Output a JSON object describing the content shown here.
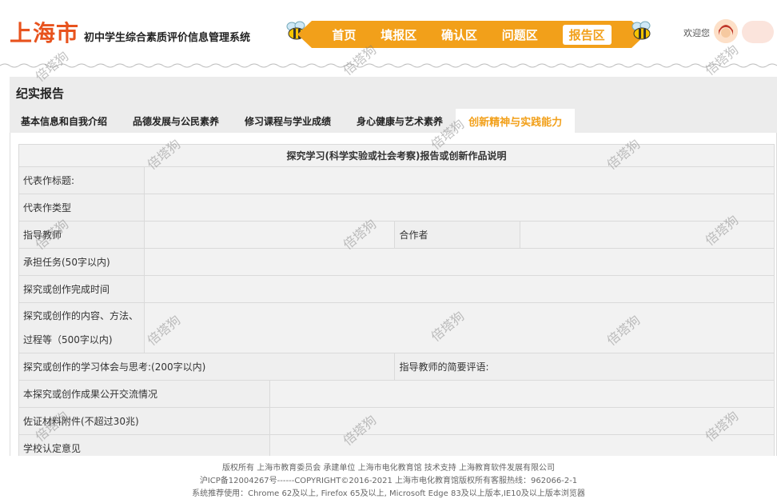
{
  "header": {
    "city": "上海市",
    "system_name": "初中学生综合素质评价信息管理系统",
    "welcome": "欢迎您"
  },
  "nav": {
    "items": [
      {
        "label": "首页",
        "active": false
      },
      {
        "label": "填报区",
        "active": false
      },
      {
        "label": "确认区",
        "active": false
      },
      {
        "label": "问题区",
        "active": false
      },
      {
        "label": "报告区",
        "active": true
      }
    ]
  },
  "page": {
    "title": "纪实报告"
  },
  "tabs": [
    {
      "label": "基本信息和自我介绍",
      "active": false
    },
    {
      "label": "品德发展与公民素养",
      "active": false
    },
    {
      "label": "修习课程与学业成绩",
      "active": false
    },
    {
      "label": "身心健康与艺术素养",
      "active": false
    },
    {
      "label": "创新精神与实践能力",
      "active": true
    }
  ],
  "form": {
    "caption": "探究学习(科学实验或社会考察)报告或创新作品说明",
    "title_label": "代表作标题:",
    "type_label": "代表作类型",
    "teacher_label": "指导教师",
    "partner_label": "合作者",
    "task_label": "承担任务(50字以内)",
    "time_label": "探究或创作完成时间",
    "content_label_1": "探究或创作的内容、方法、",
    "content_label_2": "过程等（500字以内)",
    "reflection_label": "探究或创作的学习体会与思考:(200字以内)",
    "teacher_comment_label": "指导教师的简要评语:",
    "public_label": "本探究或创作成果公开交流情况",
    "evidence_label": "佐证材料附件(不超过30兆)",
    "school_label": "学校认定意见"
  },
  "footer": {
    "line1": "版权所有 上海市教育委员会   承建单位 上海市电化教育馆   技术支持 上海教育软件发展有限公司",
    "line2": "沪ICP备12004267号------COPYRIGHT©2016-2021 上海市电化教育馆版权所有客服热线：962066-2-1",
    "line3": "系统推荐使用：Chrome 62及以上, Firefox 65及以上, Microsoft Edge 83及以上版本,IE10及以上版本浏览器"
  },
  "watermark": "倍塔狗",
  "colors": {
    "accent": "#f2a01a",
    "brand_red": "#e8531e"
  }
}
